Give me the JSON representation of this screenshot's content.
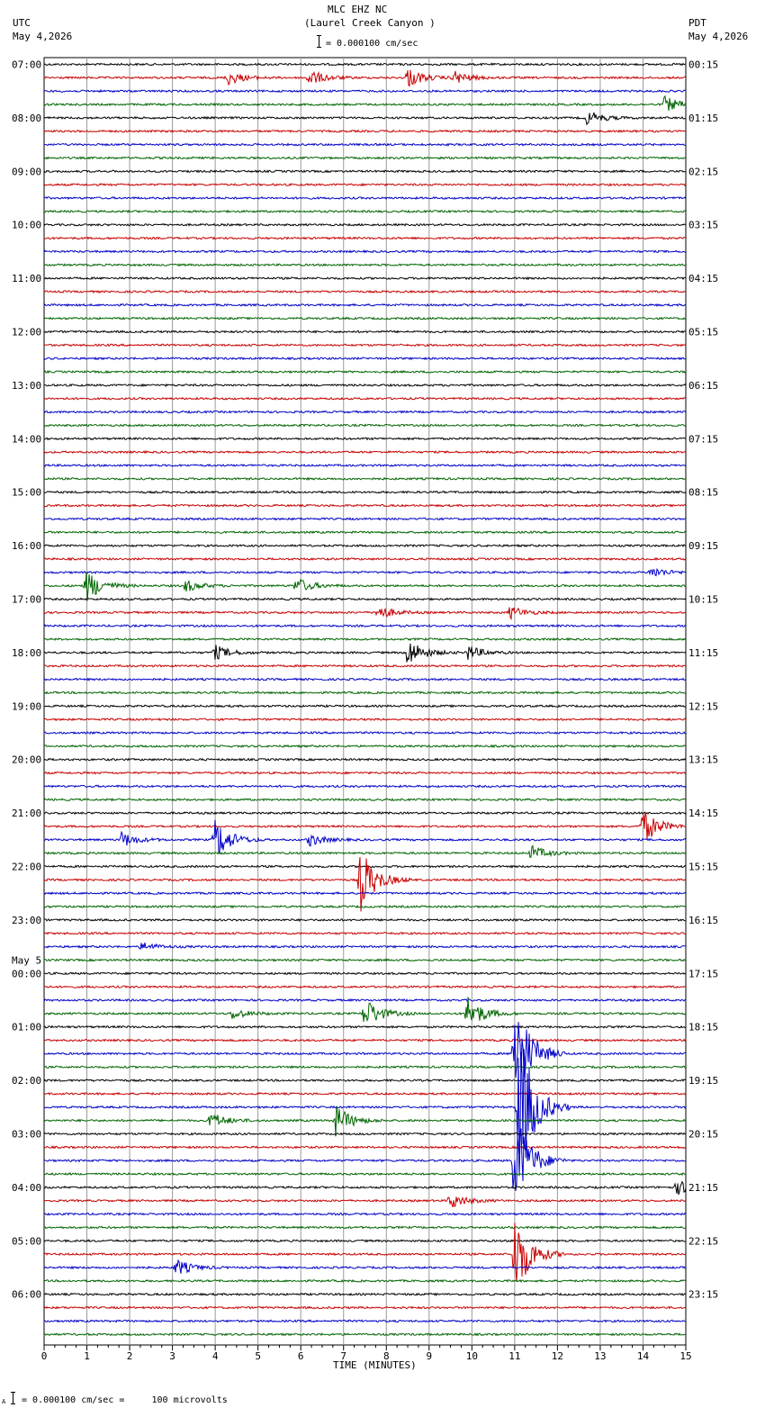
{
  "header": {
    "station": "MLC EHZ NC",
    "location": "(Laurel Creek Canyon )",
    "left_tz": "UTC",
    "left_date": "May 4,2026",
    "right_tz": "PDT",
    "right_date": "May 4,2026",
    "scale_text": "= 0.000100 cm/sec"
  },
  "footer": {
    "scale_text": "= 0.000100 cm/sec =     100 microvolts",
    "footer_mark": "A"
  },
  "chart_data": {
    "type": "line",
    "title": "MLC EHZ NC (Laurel Creek Canyon )",
    "xlabel": "TIME (MINUTES)",
    "x_ticks": [
      "0",
      "1",
      "2",
      "3",
      "4",
      "5",
      "6",
      "7",
      "8",
      "9",
      "10",
      "11",
      "12",
      "13",
      "14",
      "15"
    ],
    "xlim": [
      0,
      15
    ],
    "grid": true,
    "rows_per_hour": 4,
    "row_count": 96,
    "trace_colors": [
      "#000000",
      "#c80000",
      "#0000c8",
      "#006400"
    ],
    "left_hour_labels": [
      "07:00",
      "08:00",
      "09:00",
      "10:00",
      "11:00",
      "12:00",
      "13:00",
      "14:00",
      "15:00",
      "16:00",
      "17:00",
      "18:00",
      "19:00",
      "20:00",
      "21:00",
      "22:00",
      "23:00",
      "00:00",
      "01:00",
      "02:00",
      "03:00",
      "04:00",
      "05:00",
      "06:00"
    ],
    "left_date_change": {
      "label": "May 5",
      "hour_index": 17
    },
    "right_hour_labels": [
      "00:15",
      "01:15",
      "02:15",
      "03:15",
      "04:15",
      "05:15",
      "06:15",
      "07:15",
      "08:15",
      "09:15",
      "10:15",
      "11:15",
      "12:15",
      "13:15",
      "14:15",
      "15:15",
      "16:15",
      "17:15",
      "18:15",
      "19:15",
      "20:15",
      "21:15",
      "22:15",
      "23:15"
    ],
    "events": [
      {
        "row": 1,
        "minute": 4.3,
        "amp": 8
      },
      {
        "row": 1,
        "minute": 6.2,
        "amp": 9
      },
      {
        "row": 1,
        "minute": 8.5,
        "amp": 11
      },
      {
        "row": 1,
        "minute": 9.6,
        "amp": 7
      },
      {
        "row": 3,
        "minute": 14.5,
        "amp": 9
      },
      {
        "row": 4,
        "minute": 12.7,
        "amp": 8
      },
      {
        "row": 38,
        "minute": 14.2,
        "amp": 6
      },
      {
        "row": 39,
        "minute": 1.0,
        "amp": 18
      },
      {
        "row": 39,
        "minute": 3.3,
        "amp": 7
      },
      {
        "row": 39,
        "minute": 5.9,
        "amp": 9
      },
      {
        "row": 41,
        "minute": 7.8,
        "amp": 8
      },
      {
        "row": 41,
        "minute": 10.9,
        "amp": 7
      },
      {
        "row": 44,
        "minute": 4.0,
        "amp": 8
      },
      {
        "row": 44,
        "minute": 8.5,
        "amp": 16
      },
      {
        "row": 44,
        "minute": 9.9,
        "amp": 8
      },
      {
        "row": 57,
        "minute": 14.0,
        "amp": 20
      },
      {
        "row": 58,
        "minute": 1.8,
        "amp": 9
      },
      {
        "row": 58,
        "minute": 4.0,
        "amp": 24
      },
      {
        "row": 58,
        "minute": 6.2,
        "amp": 7
      },
      {
        "row": 59,
        "minute": 11.4,
        "amp": 8
      },
      {
        "row": 61,
        "minute": 7.4,
        "amp": 36
      },
      {
        "row": 66,
        "minute": 2.3,
        "amp": 5
      },
      {
        "row": 71,
        "minute": 4.4,
        "amp": 6
      },
      {
        "row": 71,
        "minute": 7.5,
        "amp": 18
      },
      {
        "row": 71,
        "minute": 9.9,
        "amp": 20
      },
      {
        "row": 74,
        "minute": 11.0,
        "amp": 70
      },
      {
        "row": 78,
        "minute": 11.1,
        "amp": 95
      },
      {
        "row": 79,
        "minute": 3.9,
        "amp": 9
      },
      {
        "row": 79,
        "minute": 6.8,
        "amp": 18
      },
      {
        "row": 82,
        "minute": 11.0,
        "amp": 60
      },
      {
        "row": 84,
        "minute": 14.8,
        "amp": 8
      },
      {
        "row": 85,
        "minute": 9.5,
        "amp": 9
      },
      {
        "row": 89,
        "minute": 11.0,
        "amp": 50
      },
      {
        "row": 90,
        "minute": 3.1,
        "amp": 9
      }
    ]
  }
}
